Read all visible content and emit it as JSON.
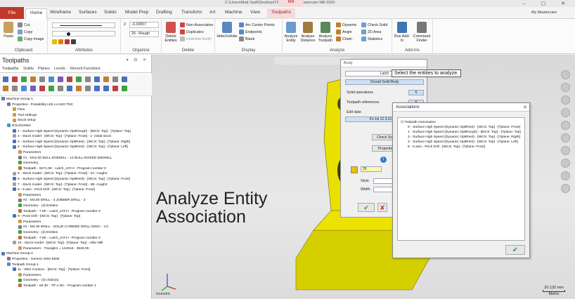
{
  "titlebar": {
    "path": "C:\\Users\\Matt Swift\\Desktop\\TP A.mcam* - Mastercam Mill 2020",
    "context_label": "Mill"
  },
  "tabs": [
    "File",
    "Home",
    "Wireframe",
    "Surfaces",
    "Solids",
    "Model Prep",
    "Drafting",
    "Transform",
    "Art",
    "Machine",
    "View",
    "Toolpaths"
  ],
  "my_mastercam": "My Mastercam",
  "ribbon": {
    "clipboard": {
      "label": "Clipboard",
      "paste": "Paste",
      "cut": "Cut",
      "copy": "Copy",
      "copy_image": "Copy Image"
    },
    "attributes": {
      "label": "Attributes"
    },
    "organize": {
      "label": "Organize",
      "z_label": "Z",
      "z_value": "-3.33057",
      "level_value": "25 : Rough"
    },
    "delete": {
      "label": "Delete",
      "delete_entities": "Delete Entities",
      "non_associative": "Non-Associative",
      "duplicates": "Duplicates",
      "undelete": "Undelete Entity"
    },
    "display": {
      "label": "Display",
      "hide_unhide": "Hide/Unhide",
      "arc_center": "Arc Center Points",
      "endpoints": "Endpoints",
      "blank": "Blank"
    },
    "analyze": {
      "label": "Analyze",
      "analyze_entity": "Analyze Entity",
      "analyze_distance": "Analyze Distance",
      "analyze_toolpath": "Analyze Toolpath",
      "dynamic": "Dynamic",
      "angle": "Angle",
      "chain": "Chain",
      "check_solid": "Check Solid",
      "area_2d": "2D Area",
      "statistics": "Statistics"
    },
    "addins": {
      "label": "Add-Ins",
      "run_addin": "Run Add-In",
      "command_finder": "Command Finder"
    }
  },
  "panel": {
    "title": "Toolpaths",
    "tabs": [
      "Toolpaths",
      "Solids",
      "Planes",
      "Levels",
      "Recent Functions"
    ],
    "tree": [
      {
        "indent": 0,
        "text": "Machine Group-1",
        "icon": "machine"
      },
      {
        "indent": 1,
        "text": "Properties - Postability Ltt2 LU-620 TNC",
        "icon": "props"
      },
      {
        "indent": 2,
        "text": "Files",
        "icon": "file"
      },
      {
        "indent": 2,
        "text": "Tool settings",
        "icon": "file"
      },
      {
        "indent": 2,
        "text": "Stock setup",
        "icon": "file"
      },
      {
        "indent": 1,
        "text": "ROUGHING",
        "icon": "group"
      },
      {
        "indent": 2,
        "text": "1 - Surface High Speed (Dynamic OptiRough) - [WCS: Top] - [Tplane: Top]",
        "icon": "op"
      },
      {
        "indent": 2,
        "text": "2 - Stock model - [WCS: Top] - [Tplane: Front] - 1- initial stock",
        "icon": "stock"
      },
      {
        "indent": 2,
        "text": "3 - Surface High Speed (Dynamic OptiRest) - [WCS: Top] - [Tplane: Right]",
        "icon": "op"
      },
      {
        "indent": 2,
        "text": "4 - Surface High Speed (Dynamic OptiRest) - [WCS: Top] - [Tplane: Left]",
        "icon": "op"
      },
      {
        "indent": 3,
        "text": "Parameters",
        "icon": "file"
      },
      {
        "indent": 3,
        "text": "#1 - M12.00 BULL ENDMILL - 12 BULL-NOSED ENDMILL",
        "icon": "tool"
      },
      {
        "indent": 3,
        "text": "Geometry",
        "icon": "geo"
      },
      {
        "indent": 3,
        "text": "Toolpath - 9471.0K - Latch_JAT.H - Program number 0",
        "icon": "tp"
      },
      {
        "indent": 2,
        "text": "5 - Stock model - [WCS: Top] - [Tplane: Front] - 2A- rough2",
        "icon": "stock"
      },
      {
        "indent": 2,
        "text": "6 - Surface High Speed (Dynamic OptiRest) - [WCS: Top] - [Tplane: Front]",
        "icon": "op"
      },
      {
        "indent": 2,
        "text": "7 - Stock model - [WCS: Top] - [Tplane: Front] - 2B- rough2",
        "icon": "stock"
      },
      {
        "indent": 2,
        "text": "8 - 5 axis - Peck Drill - [WCS: Top] - [Tplane: Front]",
        "icon": "op"
      },
      {
        "indent": 3,
        "text": "Parameters",
        "icon": "file"
      },
      {
        "indent": 3,
        "text": "#2 - M3.00 DRILL - 3 JOBBER DRILL - 3",
        "icon": "tool"
      },
      {
        "indent": 3,
        "text": "Geometry - (4) Entities",
        "icon": "geo"
      },
      {
        "indent": 3,
        "text": "Toolpath - 7.9K - Latch_JAT.H - Program number 0",
        "icon": "tp"
      },
      {
        "indent": 2,
        "text": "9 - Peck Drill - [WCS: Top] - [Tplane: Top]",
        "icon": "op"
      },
      {
        "indent": 3,
        "text": "Parameters",
        "icon": "file"
      },
      {
        "indent": 3,
        "text": "#2 - M4.00 DRILL - SOLID CARBIDE DRILL 5XDC - 4.0",
        "icon": "tool"
      },
      {
        "indent": 3,
        "text": "Geometry - (2) Entities",
        "icon": "geo"
      },
      {
        "indent": 3,
        "text": "Toolpath - 7.8K - Latch_JAT.H - Program number 0",
        "icon": "tp"
      },
      {
        "indent": 2,
        "text": "10 - Stock model - [WCS: Top] - [Tplane: Top] - After Mill",
        "icon": "stock"
      },
      {
        "indent": 3,
        "text": "Parameters - Triangles = 144518 - 3528.0K",
        "icon": "file"
      },
      {
        "indent": 0,
        "text": "Machine Group-2",
        "icon": "machine"
      },
      {
        "indent": 1,
        "text": "Properties - Generic Wire EDM",
        "icon": "props"
      },
      {
        "indent": 1,
        "text": "Toolpath Group-1",
        "icon": "group"
      },
      {
        "indent": 2,
        "text": "11 - Wire Contour - [WCS: Top] - [Tplane: Front]",
        "icon": "op"
      },
      {
        "indent": 3,
        "text": "Parameters",
        "icon": "file"
      },
      {
        "indent": 3,
        "text": "Geometry - (4) chain(s)",
        "icon": "geo"
      },
      {
        "indent": 3,
        "text": "Toolpath - 63.3K - TP A.NC - Program number 1",
        "icon": "tp"
      }
    ]
  },
  "viewport": {
    "overlay_line1": "Analyze Entity",
    "overlay_line2": "Association",
    "view_name": "Isometric",
    "scale_value": "20.132 mm",
    "scale_unit": "Metric"
  },
  "body_dialog": {
    "title": "Body",
    "name": "Latch",
    "type": "Closed Solid Body",
    "solid_operations_label": "Solid operations",
    "solid_operations_value": "6",
    "toolpath_references_label": "Toolpath references",
    "toolpath_references_value": "6",
    "edit_date_label": "Edit date",
    "edit_date_value": "Fri Jul 12 3:21:43 2",
    "check_solid": "Check Soli",
    "properties": "Propertie",
    "level_value": "25",
    "style_label": "Style",
    "width_label": "Width"
  },
  "tooltip": "Select the entities to analyze.",
  "assoc_dialog": {
    "title": "Associations",
    "root": "Toolpath Association",
    "items": [
      "6 - Surface High Speed (Dynamic OptiRest) - [WCS: Top] - [Tplane: Front]",
      "1 - Surface High Speed (Dynamic OptiRough) - [WCS: Top] - [Tplane: Top]",
      "3 - Surface High Speed (Dynamic OptiRest) - [WCS: Top] - [Tplane: Right]",
      "4 - Surface High Speed (Dynamic OptiRest) - [WCS: Top] - [Tplane: Left]",
      "8 - 5 axis - Peck Drill - [WCS: Top] - [Tplane: Front]"
    ]
  },
  "colors": {
    "file_tab": "#c0392b",
    "part_yellow": "#e8e000",
    "ok_green": "#2e9a2e",
    "cancel_red": "#d03020"
  }
}
